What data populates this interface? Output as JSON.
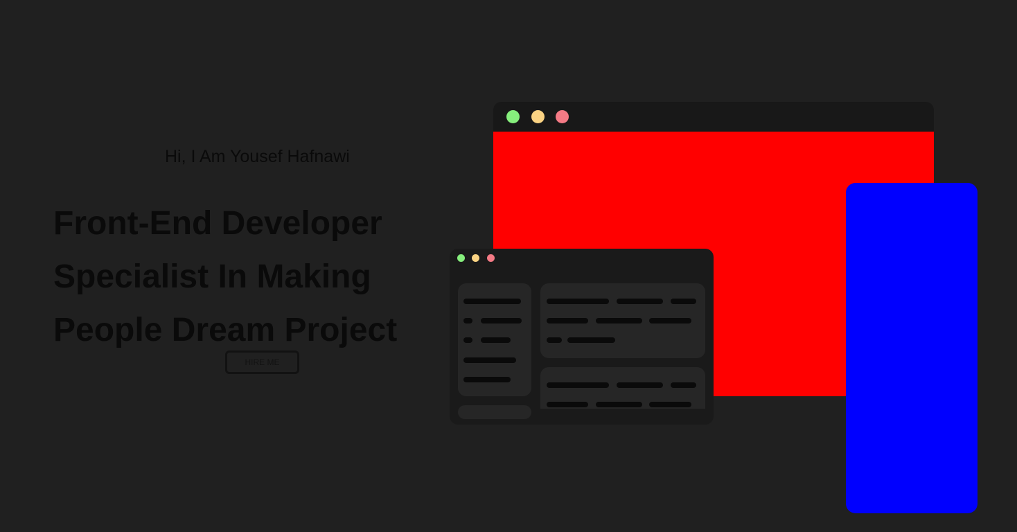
{
  "hero": {
    "greeting": "Hi, I Am Yousef Hafnawi",
    "headline_lines": [
      "Front-End Developer",
      "Specialist In Making",
      "People Dream Project"
    ],
    "hire_button": "HIRE ME"
  },
  "colors": {
    "background": "#202020",
    "browser_content": "#ff0000",
    "phone_screen": "#0000ff",
    "dot_green": "#86ef7d",
    "dot_yellow": "#fbd383",
    "dot_red": "#f47a85"
  }
}
